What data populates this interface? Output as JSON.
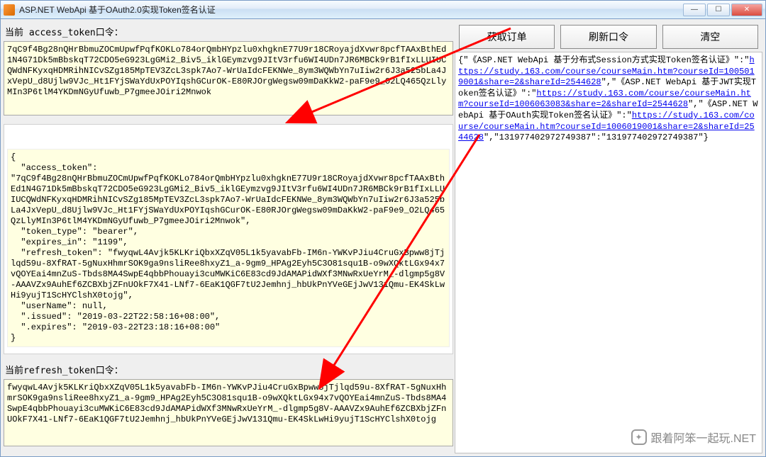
{
  "window": {
    "title": "ASP.NET WebApi 基于OAuth2.0实现Token签名认证",
    "minimize_symbol": "—",
    "maximize_symbol": "☐",
    "close_symbol": "✕"
  },
  "labels": {
    "access_token_label": "当前 access_token口令：",
    "refresh_token_label": "当前refresh_token口令："
  },
  "buttons": {
    "get_order": "获取订单",
    "refresh_token": "刷新口令",
    "clear": "清空"
  },
  "access_token_value": "7qC9f4Bg28nQHrBbmuZOCmUpwfPqfKOKLo784orQmbHYpzlu0xhgknE77U9r18CRoyajdXvwr8pcfTAAxBthEd1N4G71Dk5mBbskqT72CDO5eG923LgGMi2_Biv5_iklGEymzvg9JItV3rfu6WI4UDn7JR6MBCk9rB1fIxLLUIUCQWdNFKyxqHDMRihNICvSZg185MpTEV3ZcL3spk7Ao7-WrUaIdcFEKNWe_8ym3WQWbYn7uIiw2r6J3a525bLa4JxVepU_d8Ujlw9VJc_Ht1FYjSWaYdUxPOYIqshGCurOK-E80RJOrgWegsw09mDaKkW2-paF9e9_O2LQ465QzLlyMIn3P6tlM4YKDmNGyUfuwb_P7gmeeJOiri2Mnwok",
  "token_json_text": "{\n  \"access_token\":\n\"7qC9f4Bg28nQHrBbmuZOCmUpwfPqfKOKLo784orQmbHYpzlu0xhgknE77U9r18CRoyajdXvwr8pcfTAAxBthEd1N4G71Dk5mBbskqT72CDO5eG923LgGMi2_Biv5_iklGEymzvg9JItV3rfu6WI4UDn7JR6MBCk9rB1fIxLLUIUCQWdNFKyxqHDMRihNICvSZg185MpTEV3ZcL3spk7Ao7-WrUaIdcFEKNWe_8ym3WQWbYn7uIiw2r6J3a525bLa4JxVepU_d8Ujlw9VJc_Ht1FYjSWaYdUxPOYIqshGCurOK-E80RJOrgWegsw09mDaKkW2-paF9e9_O2LQ465QzLlyMIn3P6tlM4YKDmNGyUfuwb_P7gmeeJOiri2Mnwok\",\n  \"token_type\": \"bearer\",\n  \"expires_in\": \"1199\",\n  \"refresh_token\": \"fwyqwL4Avjk5KLKriQbxXZqV05L1k5yavabFb-IM6n-YWKvPJiu4CruGxBpww8jTjlqd59u-8XfRAT-5gNuxHhmrSOK9ga9nsliRee8hxyZ1_a-9gm9_HPAg2Eyh5C3O81squ1B-o9wXQktLGx94x7vQOYEai4mnZuS-Tbds8MA4SwpE4qbbPhouayi3cuMWKiC6E83cd9JdAMAPidWXf3MNwRxUeYrM_-dlgmp5g8V-AAAVZx9AuhEf6ZCBXbjZFnUOkF7X41-LNf7-6EaK1QGF7tU2Jemhnj_hbUkPnYVeGEjJwV131Qmu-EK4SkLwHi9yujT1ScHYClshX0tojg\",\n  \"userName\": null,\n  \".issued\": \"2019-03-22T22:58:16+08:00\",\n  \".expires\": \"2019-03-22T23:18:16+08:00\"\n}",
  "refresh_token_value": "fwyqwL4Avjk5KLKriQbxXZqV05L1k5yavabFb-IM6n-YWKvPJiu4CruGxBpww8jTjlqd59u-8XfRAT-5gNuxHhmrSOK9ga9nsliRee8hxyZ1_a-9gm9_HPAg2Eyh5C3O81squ1B-o9wXQktLGx94x7vQOYEai4mnZuS-Tbds8MA4SwpE4qbbPhouayi3cuMWKiC6E83cd9JdAMAPidWXf3MNwRxUeYrM_-dlgmp5g8V-AAAVZx9AuhEf6ZCBXbjZFnUOkF7X41-LNf7-6EaK1QGF7tU2Jemhnj_hbUkPnYVeGEjJwV131Qmu-EK4SkLwHi9yujT1ScHYClshX0tojg",
  "result": {
    "pre1": "{\"《ASP.NET WebApi 基于分布式Session方式实现Token签名认证》\":\"",
    "link1": "https://study.163.com/course/courseMain.htm?courseId=1005019001&share=2&shareId=2544628",
    "mid1": "\",\"《ASP.NET WebApi 基于JWT实现Token签名认证》\":\"",
    "link2": "https://study.163.com/course/courseMain.htm?courseId=1006063083&share=2&shareId=2544628",
    "mid2": "\",\"《ASP.NET WebApi 基于OAuth实现Token签名认证》\":\"",
    "link3": "https://study.163.com/course/courseMain.htm?courseId=1006019001&share=2&shareId=2544628",
    "post": "\",\"131977402972749387\":\"131977402972749387\"}"
  },
  "watermark": "跟着阿笨一起玩.NET"
}
